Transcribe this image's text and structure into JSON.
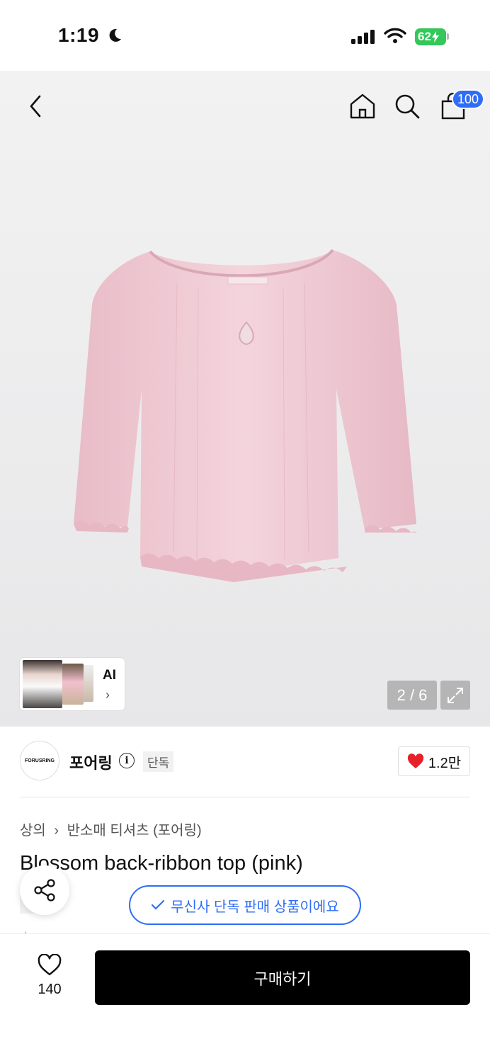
{
  "status_bar": {
    "time": "1:19",
    "battery": "62"
  },
  "top_nav": {
    "cart_badge": "100",
    "icons": [
      "back-arrow-icon",
      "home-icon",
      "search-icon",
      "shopping-bag-icon"
    ]
  },
  "gallery": {
    "ai_label": "AI",
    "counter": "2 / 6"
  },
  "brand": {
    "logo_text": "FORUSRING",
    "name": "포어링",
    "exclusive_tag": "단독",
    "like_count": "1.2만"
  },
  "product": {
    "breadcrumb": [
      "상의",
      "반소매 티셔츠 (포어링)"
    ],
    "title": "Blossom back-ribbon top (pink)",
    "exclusive_tag": "단독",
    "exclusive_pill": "무신사 단독 판매 상품이에요"
  },
  "bottom_bar": {
    "wish_count": "140",
    "buy_label": "구매하기"
  },
  "colors": {
    "accent_blue": "#2f6df6",
    "heart_red": "#e8202a",
    "buy_bg": "#000000",
    "shirt_pink": "#f1cdd6"
  }
}
